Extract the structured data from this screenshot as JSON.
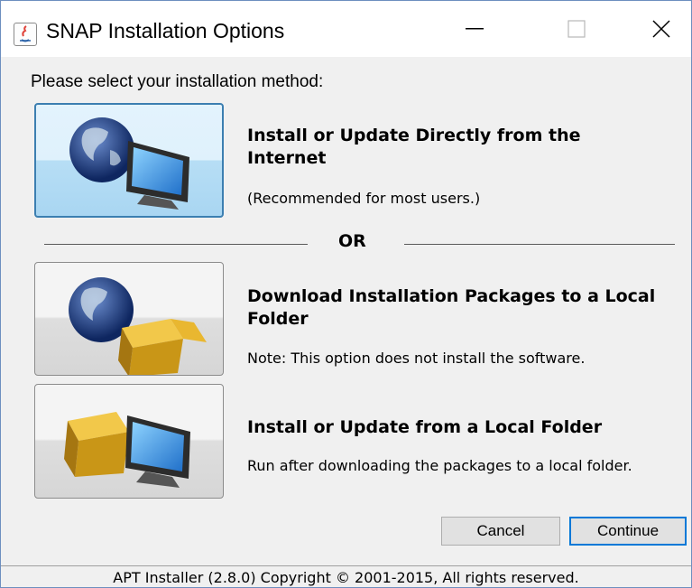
{
  "window": {
    "title": "SNAP Installation Options",
    "controls": {
      "minimize_icon": "minimize-icon",
      "maximize_icon": "maximize-icon",
      "close_icon": "close-icon"
    }
  },
  "main": {
    "prompt": "Please select your installation method:",
    "separator_label": "OR",
    "options": [
      {
        "title": "Install or Update Directly from the Internet",
        "description": "(Recommended for most users.)",
        "icon": "globe-monitor-icon",
        "selected": true
      },
      {
        "title": "Download Installation Packages to a Local Folder",
        "description": "Note: This option does not install the software.",
        "icon": "globe-box-icon",
        "selected": false
      },
      {
        "title": "Install or Update from a Local Folder",
        "description": "Run after downloading the packages to a local folder.",
        "icon": "box-monitor-icon",
        "selected": false
      }
    ]
  },
  "buttons": {
    "cancel": "Cancel",
    "continue": "Continue"
  },
  "footer": {
    "text": "APT Installer (2.8.0) Copyright © 2001-2015, All rights reserved."
  },
  "colors": {
    "selected_border": "#3c7fb1",
    "default_button_border": "#0078d7"
  }
}
